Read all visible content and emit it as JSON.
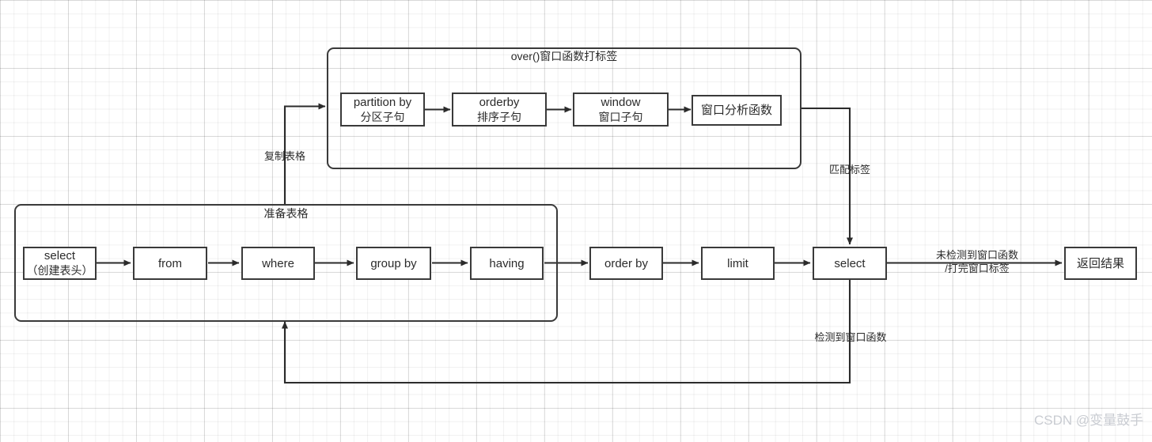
{
  "diagram": {
    "watermark": "CSDN @变量鼓手",
    "groups": [
      {
        "title": "over()窗口函数打标签"
      },
      {
        "title": "准备表格"
      }
    ],
    "window_nodes": [
      {
        "line1": "partition by",
        "line2": "分区子句"
      },
      {
        "line1": "orderby",
        "line2": "排序子句"
      },
      {
        "line1": "window",
        "line2": "窗口子句"
      },
      {
        "line1": "窗口分析函数",
        "line2": ""
      }
    ],
    "prepare_nodes": [
      {
        "line1": "select",
        "line2": "（创建表头）"
      },
      {
        "line1": "from",
        "line2": ""
      },
      {
        "line1": "where",
        "line2": ""
      },
      {
        "line1": "group by",
        "line2": ""
      },
      {
        "line1": "having",
        "line2": ""
      }
    ],
    "tail_nodes": [
      {
        "line1": "order by",
        "line2": ""
      },
      {
        "line1": "limit",
        "line2": ""
      },
      {
        "line1": "select",
        "line2": ""
      },
      {
        "line1": "返回结果",
        "line2": ""
      }
    ],
    "edge_labels": {
      "copy_table": "复制表格",
      "match_tag": "匹配标签",
      "no_window_fn_line1": "未检测到窗口函数",
      "no_window_fn_line2": "/打完窗口标签",
      "window_fn_detected": "检测到窗口函数"
    }
  }
}
